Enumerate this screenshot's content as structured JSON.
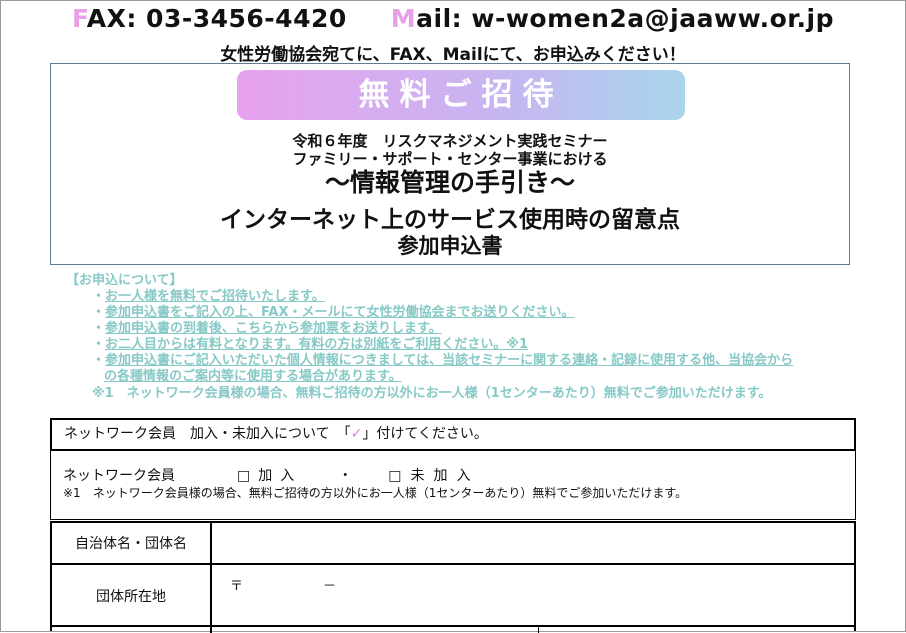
{
  "header": {
    "fax_initial": "F",
    "fax_rest": "AX: 03-3456-4420",
    "mail_initial": "M",
    "mail_rest": "ail: w-women2a@jaaww.or.jp",
    "instruction": "女性労働協会宛てに、FAX、Mailにて、お申込みください！"
  },
  "title_box": {
    "banner": "無料ご招待",
    "line1": "令和６年度　リスクマネジメント実践セミナー",
    "line2": "ファミリー・サポート・センター事業における",
    "line3": "～情報管理の手引き～",
    "line4": "インターネット上のサービス使用時の留意点",
    "line5": "参加申込書"
  },
  "notes": {
    "heading": "【お申込について】",
    "items": [
      "お一人様を無料でご招待いたします。",
      "参加申込書をご記入の上、FAX・メールにて女性労働協会までお送りください。",
      "参加申込書の到着後、こちらから参加票をお送りします。",
      "お二人目からは有料となります。有料の方は別紙をご利用ください。※1",
      "参加申込書にご記入いただいた個人情報につきましては、当該セミナーに関する連絡・記録に使用する他、当協会から"
    ],
    "item5_cont": "の各種情報のご案内等に使用する場合があります。",
    "footnote": "※1　ネットワーク会員様の場合、無料ご招待の方以外にお一人様（1センターあたり）無料でご参加いただけます。"
  },
  "form": {
    "row1_text_a": "ネットワーク会員　加入・未加入について　「",
    "row1_check": "✓",
    "row1_text_b": "」付けてください。",
    "row2_label": "ネットワーク会員",
    "option_joined": "□加入",
    "separator": "・",
    "option_not_joined": "□未加入",
    "row2_note": "※1　ネットワーク会員様の場合、無料ご招待の方以外にお一人様（1センターあたり）無料でご参加いただけます。",
    "org_label": "自治体名・団体名",
    "address_label": "団体所在地",
    "postal_mark": "〒",
    "postal_dash": "－"
  }
}
